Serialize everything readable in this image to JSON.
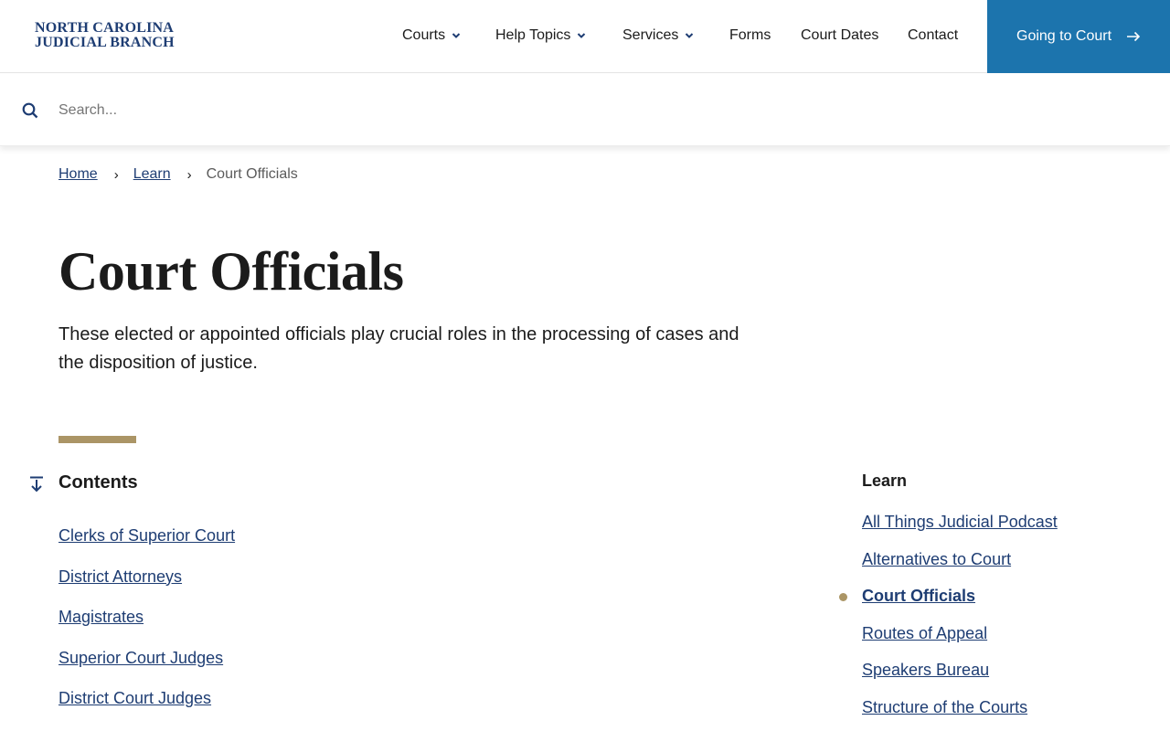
{
  "header": {
    "logo_line1": "NORTH CAROLINA",
    "logo_line2": "JUDICIAL BRANCH",
    "nav": [
      {
        "label": "Courts",
        "has_dropdown": true
      },
      {
        "label": "Help Topics",
        "has_dropdown": true
      },
      {
        "label": "Services",
        "has_dropdown": true
      },
      {
        "label": "Forms",
        "has_dropdown": false
      },
      {
        "label": "Court Dates",
        "has_dropdown": false
      },
      {
        "label": "Contact",
        "has_dropdown": false
      }
    ],
    "cta_label": "Going to Court"
  },
  "search": {
    "placeholder": "Search...",
    "value": ""
  },
  "breadcrumb": {
    "home": "Home",
    "learn": "Learn",
    "current": "Court Officials"
  },
  "page": {
    "title": "Court Officials",
    "intro": "These elected or appointed officials play crucial roles in the processing of cases and the disposition of justice."
  },
  "contents": {
    "title": "Contents",
    "items": [
      "Clerks of Superior Court",
      "District Attorneys",
      "Magistrates",
      "Superior Court Judges",
      "District Court Judges"
    ]
  },
  "sidebar": {
    "title": "Learn",
    "items": [
      {
        "label": "All Things Judicial Podcast",
        "active": false
      },
      {
        "label": "Alternatives to Court",
        "active": false
      },
      {
        "label": "Court Officials",
        "active": true
      },
      {
        "label": "Routes of Appeal",
        "active": false
      },
      {
        "label": "Speakers Bureau",
        "active": false
      },
      {
        "label": "Structure of the Courts",
        "active": false
      }
    ]
  },
  "colors": {
    "brand_navy": "#1e3d73",
    "cta_blue": "#1c74ad",
    "accent_gold": "#ab9566"
  }
}
